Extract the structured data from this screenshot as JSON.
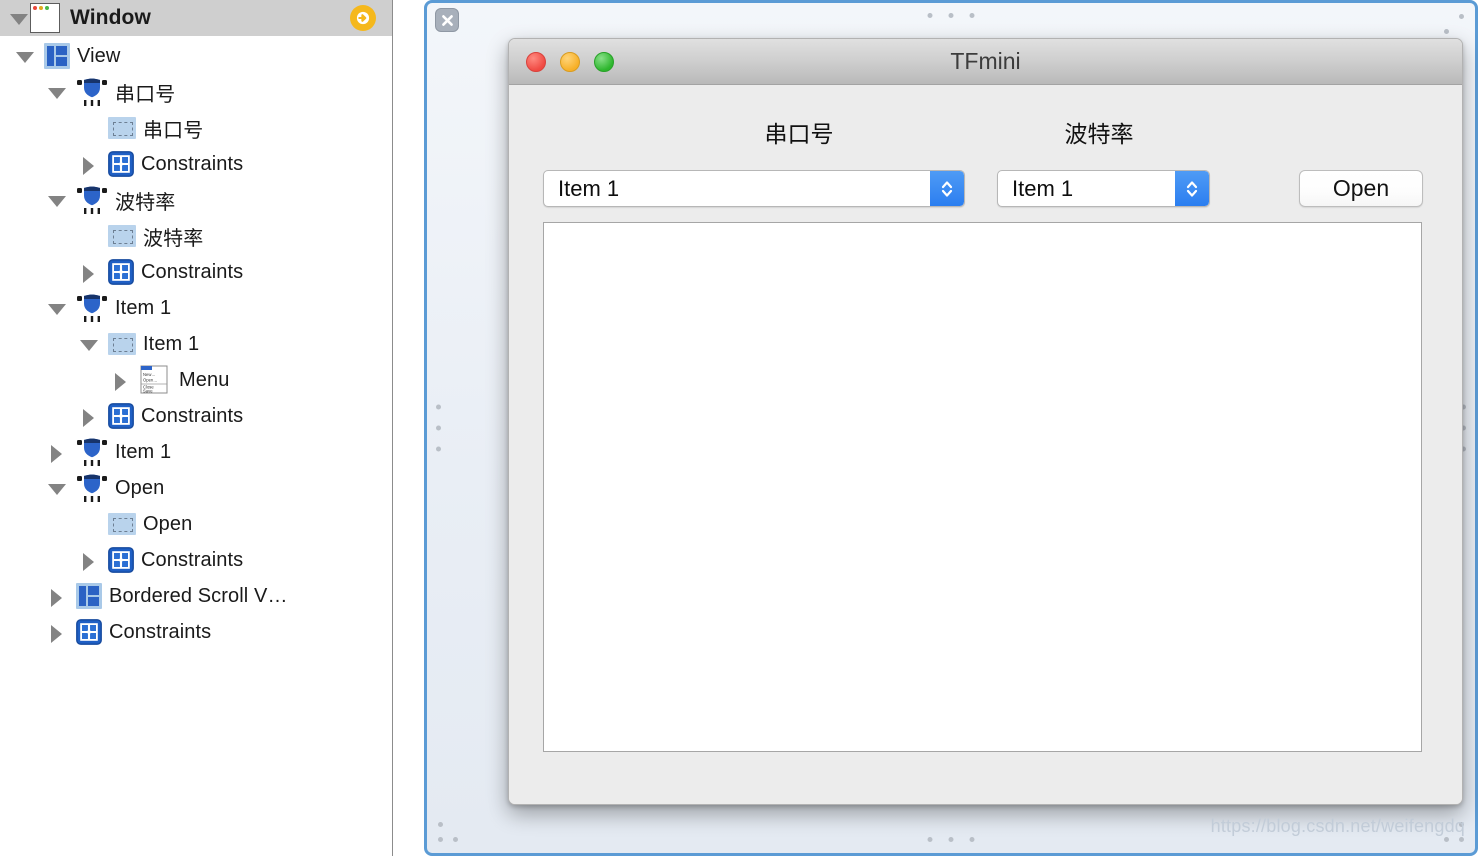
{
  "outline": {
    "header": {
      "label": "Window",
      "icon": "window-icon",
      "badge_icon": "orange-arrow-badge"
    },
    "rows": [
      {
        "label": "View",
        "icon": "view-icon",
        "indent": 0,
        "disclosure": "open"
      },
      {
        "label": "串口号",
        "icon": "popup-button-icon",
        "indent": 1,
        "disclosure": "open"
      },
      {
        "label": "串口号",
        "icon": "label-icon",
        "indent": 2,
        "disclosure": "none"
      },
      {
        "label": "Constraints",
        "icon": "constraints-icon",
        "indent": 2,
        "disclosure": "closed"
      },
      {
        "label": "波特率",
        "icon": "popup-button-icon",
        "indent": 1,
        "disclosure": "open"
      },
      {
        "label": "波特率",
        "icon": "label-icon",
        "indent": 2,
        "disclosure": "none"
      },
      {
        "label": "Constraints",
        "icon": "constraints-icon",
        "indent": 2,
        "disclosure": "closed"
      },
      {
        "label": "Item 1",
        "icon": "popup-button-icon",
        "indent": 1,
        "disclosure": "open"
      },
      {
        "label": "Item 1",
        "icon": "label-icon",
        "indent": 2,
        "disclosure": "open"
      },
      {
        "label": "Menu",
        "icon": "menu-icon",
        "indent": 3,
        "disclosure": "closed"
      },
      {
        "label": "Constraints",
        "icon": "constraints-icon",
        "indent": 2,
        "disclosure": "closed"
      },
      {
        "label": "Item 1",
        "icon": "popup-button-icon",
        "indent": 1,
        "disclosure": "closed"
      },
      {
        "label": "Open",
        "icon": "popup-button-icon",
        "indent": 1,
        "disclosure": "open"
      },
      {
        "label": "Open",
        "icon": "label-icon",
        "indent": 2,
        "disclosure": "none"
      },
      {
        "label": "Constraints",
        "icon": "constraints-icon",
        "indent": 2,
        "disclosure": "closed"
      },
      {
        "label": "Bordered Scroll V…",
        "icon": "scroll-view-icon",
        "indent": 1,
        "disclosure": "closed"
      },
      {
        "label": "Constraints",
        "icon": "constraints-icon",
        "indent": 1,
        "disclosure": "closed"
      }
    ]
  },
  "canvas": {
    "close_icon": "close-x-icon",
    "watermark": "https://blog.csdn.net/weifengdq",
    "border_color": "#5b9bd5"
  },
  "tfmini": {
    "title": "TFmini",
    "traffic_lights": [
      {
        "name": "close",
        "color": "#f04a43"
      },
      {
        "name": "minimize",
        "color": "#f7b028"
      },
      {
        "name": "zoom",
        "color": "#2db62d"
      }
    ],
    "port_label": "串口号",
    "port_value": "Item 1",
    "baud_label": "波特率",
    "baud_value": "Item 1",
    "open_button": "Open",
    "accent_color": "#2b7ef0"
  }
}
